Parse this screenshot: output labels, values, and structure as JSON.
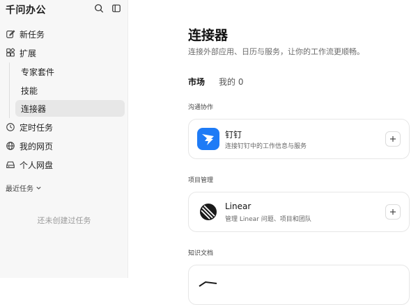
{
  "sidebar": {
    "brand": "千问办公",
    "nav": [
      {
        "label": "新任务",
        "icon": "edit-icon"
      },
      {
        "label": "扩展",
        "icon": "extensions-icon"
      },
      {
        "label": "定时任务",
        "icon": "clock-icon"
      },
      {
        "label": "我的网页",
        "icon": "globe-icon"
      },
      {
        "label": "个人网盘",
        "icon": "drive-icon"
      }
    ],
    "extension_children": [
      {
        "label": "专家套件",
        "active": false
      },
      {
        "label": "技能",
        "active": false
      },
      {
        "label": "连接器",
        "active": true
      }
    ],
    "recent_label": "最近任务",
    "empty_text": "还未创建过任务"
  },
  "main": {
    "title": "连接器",
    "subtitle": "连接外部应用、日历与服务，让你的工作流更顺畅。",
    "tabs": [
      {
        "label": "市场",
        "active": true
      },
      {
        "label": "我的 0",
        "active": false
      }
    ],
    "sections": [
      {
        "heading": "沟通协作",
        "items": [
          {
            "name": "钉钉",
            "description": "连接钉钉中的工作信息与服务",
            "icon": "dingtalk-logo-icon",
            "color": "#1e7bf6"
          }
        ]
      },
      {
        "heading": "项目管理",
        "items": [
          {
            "name": "Linear",
            "description": "管理 Linear 问题、项目和团队",
            "icon": "linear-logo-icon",
            "color": "#1a1a1a"
          }
        ]
      },
      {
        "heading": "知识文档",
        "items": []
      }
    ]
  },
  "colors": {
    "sidebar_bg": "#f7f7f7",
    "active_item_bg": "#e7e7e7",
    "dingtalk_blue": "#1e7bf6"
  }
}
